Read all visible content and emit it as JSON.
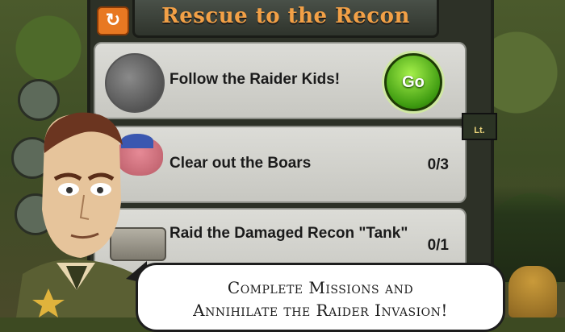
{
  "header": {
    "title": "Rescue to the Recon"
  },
  "missions": [
    {
      "label": "Follow the Raider Kids!",
      "action": "Go"
    },
    {
      "label": "Clear out the Boars",
      "progress": "0/3"
    },
    {
      "label": "Raid the Damaged Recon \"Tank\"",
      "progress": "0/1"
    }
  ],
  "speech": {
    "line1": "Complete Missions and",
    "line2": "Annihilate the Raider Invasion!"
  },
  "side_sign": {
    "text": "Lt."
  },
  "colors": {
    "title": "#f2a046",
    "go": "#3d9a10",
    "back": "#e87822"
  }
}
